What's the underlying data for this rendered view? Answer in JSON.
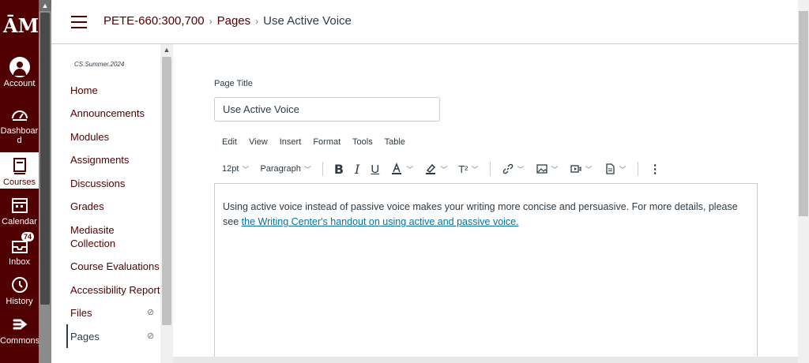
{
  "global_nav": {
    "logo": "ĀM",
    "items": [
      {
        "label": "Account"
      },
      {
        "label": "Dashboard"
      },
      {
        "label": "Courses"
      },
      {
        "label": "Calendar"
      },
      {
        "label": "Inbox",
        "badge": "74"
      },
      {
        "label": "History"
      },
      {
        "label": "Commons"
      }
    ]
  },
  "breadcrumb": {
    "course": "PETE-660:300,700",
    "section": "Pages",
    "current": "Use Active Voice"
  },
  "course_nav": {
    "term": "CS.Summer.2024",
    "items": [
      {
        "label": "Home"
      },
      {
        "label": "Announcements"
      },
      {
        "label": "Modules"
      },
      {
        "label": "Assignments"
      },
      {
        "label": "Discussions"
      },
      {
        "label": "Grades"
      },
      {
        "label": "Mediasite Collection"
      },
      {
        "label": "Course Evaluations"
      },
      {
        "label": "Accessibility Report"
      },
      {
        "label": "Files"
      },
      {
        "label": "Pages"
      }
    ]
  },
  "editor": {
    "page_title_label": "Page Title",
    "page_title_value": "Use Active Voice",
    "menu": [
      "Edit",
      "View",
      "Insert",
      "Format",
      "Tools",
      "Table"
    ],
    "font_size": "12pt",
    "block_format": "Paragraph",
    "body_text": "Using active voice instead of passive voice makes your writing more concise and persuasive. For more details, please see ",
    "body_link": "the Writing Center's handout on using active and passive voice."
  },
  "colors": {
    "brand": "#500000",
    "link": "#0770a3"
  }
}
